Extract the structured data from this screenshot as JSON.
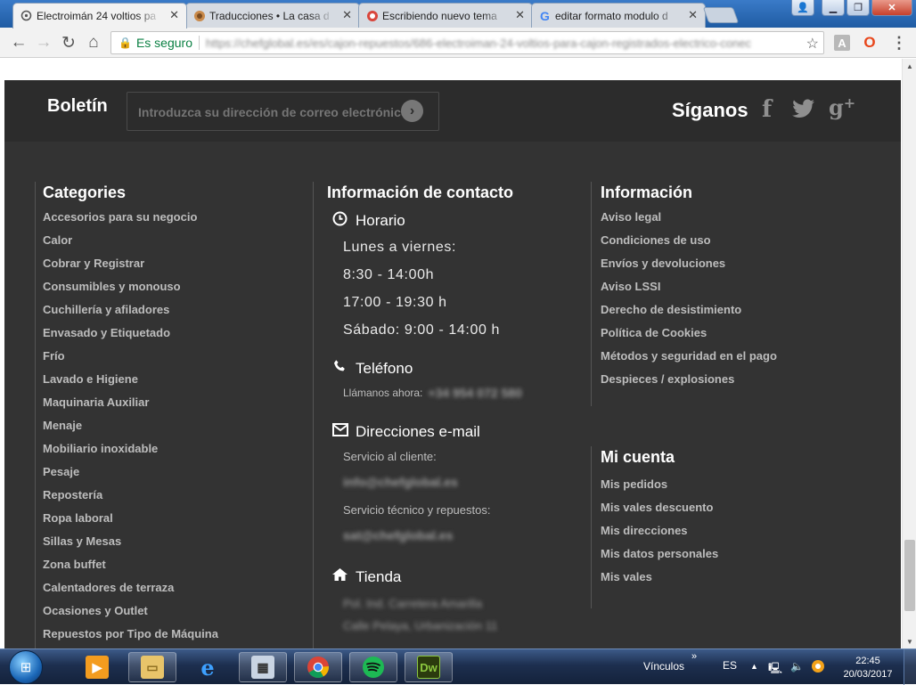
{
  "browser": {
    "tabs": [
      {
        "title": "Electroimán 24 voltios pa",
        "favicon": "circuit-icon",
        "active": true
      },
      {
        "title": "Traducciones • La casa d",
        "favicon": "house-icon",
        "active": false
      },
      {
        "title": "Escribiendo nuevo tema",
        "favicon": "forum-icon",
        "active": false
      },
      {
        "title": "editar formato modulo d",
        "favicon": "google-icon",
        "active": false
      }
    ],
    "secure_label": "Es seguro",
    "url": "https://chefglobal.es/es/cajon-repuestos/686-electroiman-24-voltios-para-cajon-registrados-electrico-conec"
  },
  "newsletter": {
    "title": "Boletín",
    "placeholder": "Introduzca su dirección de correo electrónico"
  },
  "follow": {
    "title": "Síganos",
    "networks": [
      "facebook-icon",
      "twitter-icon",
      "google-plus-icon"
    ]
  },
  "categories": {
    "title": "Categories",
    "items": [
      "Accesorios para su negocio",
      "Calor",
      "Cobrar y Registrar",
      "Consumibles y monouso",
      "Cuchillería y afiladores",
      "Envasado y Etiquetado",
      "Frío",
      "Lavado e Higiene",
      "Maquinaria Auxiliar",
      "Menaje",
      "Mobiliario inoxidable",
      "Pesaje",
      "Repostería",
      "Ropa laboral",
      "Sillas y Mesas",
      "Zona buffet",
      "Calentadores de terraza",
      "Ocasiones y Outlet",
      "Repuestos por Tipo de Máquina"
    ]
  },
  "contact": {
    "title": "Información de contacto",
    "schedule_title": "Horario",
    "schedule_lines": [
      "Lunes a viernes:",
      "8:30 - 14:00h",
      "17:00 - 19:30 h",
      "Sábado: 9:00 - 14:00 h"
    ],
    "phone_title": "Teléfono",
    "phone_prefix": "Llámanos ahora:",
    "phone_number": "+34 954 072 580",
    "email_title": "Direcciones e-mail",
    "customer_service_label": "Servicio al cliente:",
    "customer_service_email": "info@chefglobal.es",
    "tech_service_label": "Servicio técnico y repuestos:",
    "tech_service_email": "sat@chefglobal.es",
    "store_title": "Tienda",
    "store_address_1": "Pol. Ind. Carretera Amarilla",
    "store_address_2": "Calle Pelaya, Urbanización 11"
  },
  "information": {
    "title": "Información",
    "items": [
      "Aviso legal",
      "Condiciones de uso",
      "Envíos y devoluciones",
      "Aviso LSSI",
      "Derecho de desistimiento",
      "Política de Cookies",
      "Métodos y seguridad en el pago",
      "Despieces / explosiones"
    ]
  },
  "account": {
    "title": "Mi cuenta",
    "items": [
      "Mis pedidos",
      "Mis vales descuento",
      "Mis direcciones",
      "Mis datos personales",
      "Mis vales"
    ]
  },
  "taskbar": {
    "links_label": "Vínculos",
    "language": "ES",
    "time": "22:45",
    "date": "20/03/2017",
    "apps": [
      "media-player-icon",
      "file-explorer-icon",
      "internet-explorer-icon",
      "calculator-icon",
      "chrome-icon",
      "spotify-icon",
      "dreamweaver-icon"
    ]
  }
}
